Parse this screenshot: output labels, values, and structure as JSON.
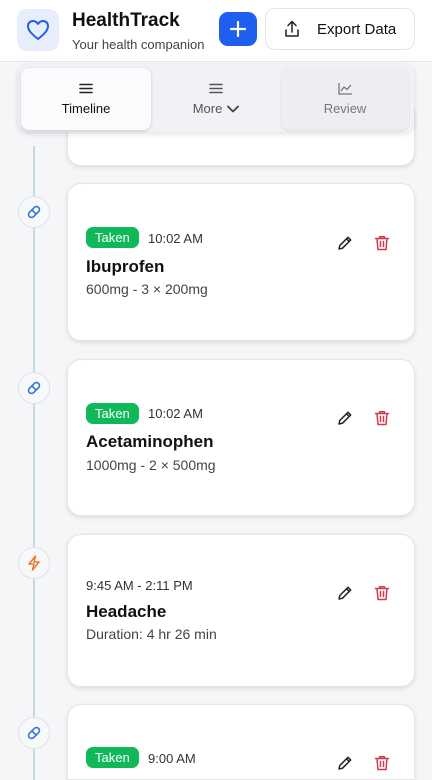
{
  "app": {
    "title": "HealthTrack",
    "subtitle": "Your health companion",
    "export_label": "Export Data",
    "icons": {
      "logo": "heart-icon",
      "add": "plus-icon",
      "export": "upload-icon"
    }
  },
  "tabs": [
    {
      "label": "Timeline",
      "icon": "menu-icon",
      "active": true
    },
    {
      "label": "More",
      "icon": "menu-icon",
      "active": false
    },
    {
      "label": "Review",
      "icon": "chart-icon",
      "active": false
    }
  ],
  "entries": [
    {
      "type": "medication",
      "badge": "Taken",
      "time": "10:02 AM",
      "name": "Ibuprofen",
      "detail": "600mg - 3 × 200mg",
      "icon": "pill-icon"
    },
    {
      "type": "medication",
      "badge": "Taken",
      "time": "10:02 AM",
      "name": "Acetaminophen",
      "detail": "1000mg - 2 × 500mg",
      "icon": "pill-icon"
    },
    {
      "type": "symptom",
      "badge": "",
      "time": "9:45 AM - 2:11 PM",
      "name": "Headache",
      "detail": "Duration: 4 hr 26 min",
      "icon": "lightning-icon"
    },
    {
      "type": "medication",
      "badge": "Taken",
      "time": "9:00 AM",
      "name": "",
      "detail": "",
      "icon": "pill-icon"
    }
  ],
  "colors": {
    "accent": "#1f5ff0",
    "taken_badge": "#10b85a",
    "delete": "#d13a4a",
    "symptom_icon": "#e8772e",
    "pill_icon": "#3a73d6"
  }
}
